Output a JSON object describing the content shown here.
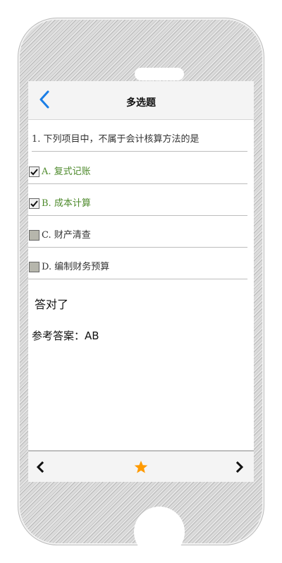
{
  "nav": {
    "title": "多选题",
    "back_icon": "chevron-left-icon"
  },
  "question": {
    "text": "1. 下列项目中，不属于会计核算方法的是"
  },
  "options": [
    {
      "label": "A. 复式记账",
      "checked": true,
      "correct": true
    },
    {
      "label": "B. 成本计算",
      "checked": true,
      "correct": true
    },
    {
      "label": "C. 财产清查",
      "checked": false,
      "correct": false
    },
    {
      "label": "D. 编制财务预算",
      "checked": false,
      "correct": false
    }
  ],
  "result": {
    "text": "答对了"
  },
  "reference_answer": {
    "text": "参考答案：AB"
  },
  "bottom_bar": {
    "prev_icon": "chevron-left-icon",
    "favorite_icon": "star-icon",
    "next_icon": "chevron-right-icon"
  },
  "colors": {
    "accent_blue": "#1a7ee6",
    "correct_green": "#4e8a2c",
    "star_orange": "#ff9a00"
  }
}
